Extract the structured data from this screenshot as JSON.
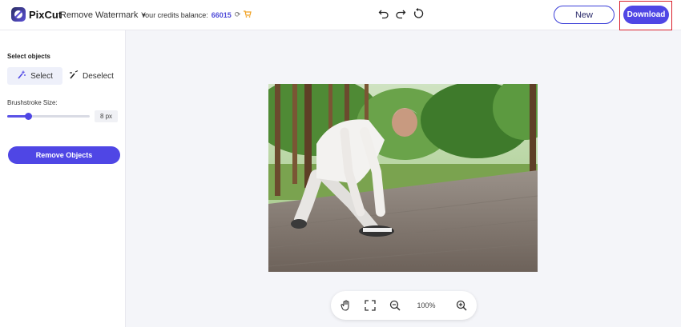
{
  "header": {
    "brand": "PixCut",
    "tool_menu": "Remove Watermark",
    "credits_label": "Your credits balance:",
    "credits_value": "66015",
    "new_label": "New",
    "download_label": "Download"
  },
  "sidebar": {
    "section_title": "Select objects",
    "select_label": "Select",
    "deselect_label": "Deselect",
    "brush_label": "Brushstroke Size:",
    "brush_value_fraction": 0.25,
    "brush_size": "8 px",
    "remove_label": "Remove Objects"
  },
  "zoom": {
    "level": "100%"
  },
  "colors": {
    "accent": "#4f46e5",
    "highlight_frame": "#d9202c"
  },
  "icons": {
    "undo": "undo-icon",
    "redo": "redo-icon",
    "reset": "reset-icon",
    "pan": "hand-icon",
    "fit": "fit-screen-icon",
    "zoom_out": "zoom-out-icon",
    "zoom_in": "zoom-in-icon",
    "refresh": "refresh-icon",
    "cart": "cart-icon"
  }
}
